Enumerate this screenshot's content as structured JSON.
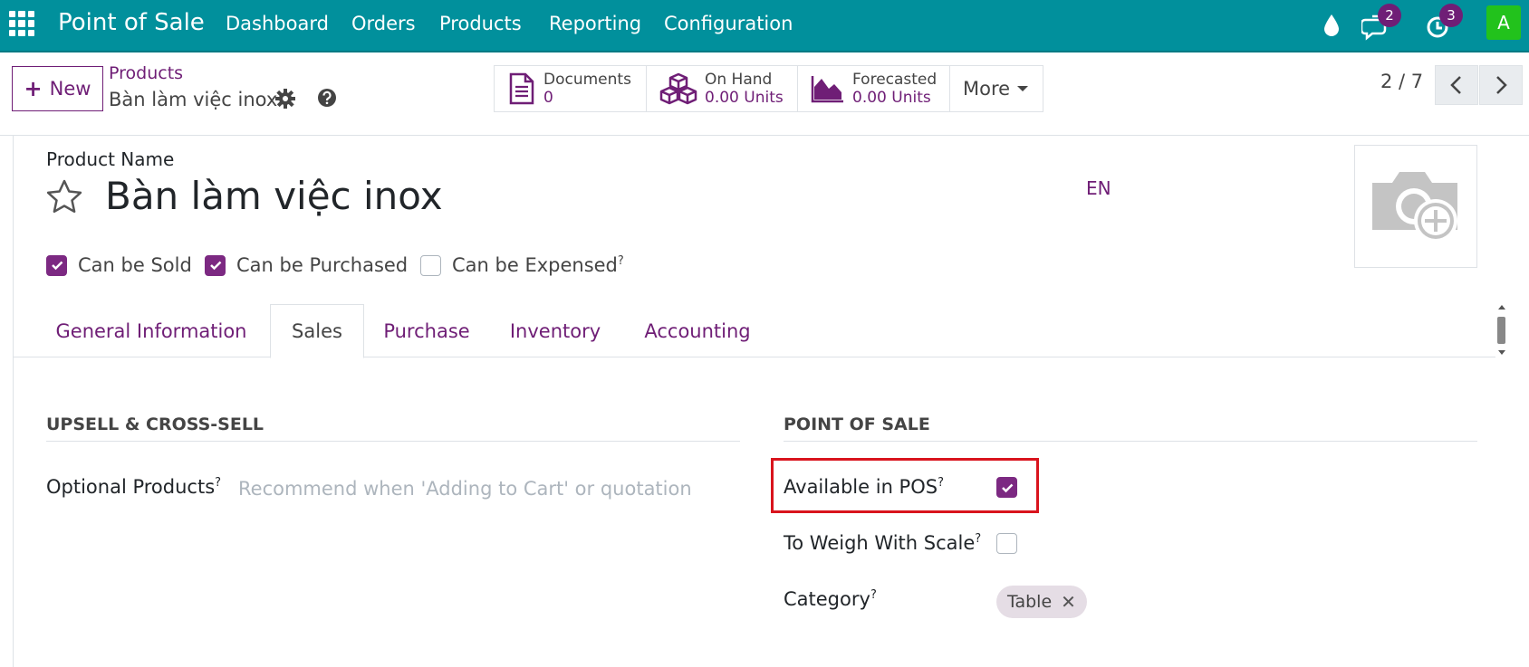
{
  "nav": {
    "brand": "Point of Sale",
    "menu": [
      "Dashboard",
      "Orders",
      "Products",
      "Reporting",
      "Configuration"
    ],
    "messages_count": "2",
    "activities_count": "3",
    "avatar_letter": "A",
    "icons": [
      "apps-grid-icon",
      "water-drop-icon",
      "chat-icon",
      "clock-icon"
    ]
  },
  "control": {
    "new_label": "New",
    "breadcrumb_parent": "Products",
    "breadcrumb_current": "Bàn làm việc inox",
    "stats": [
      {
        "label": "Documents",
        "value": "0",
        "icon": "document-icon"
      },
      {
        "label": "On Hand",
        "value": "0.00 Units",
        "icon": "cubes-icon"
      },
      {
        "label": "Forecasted",
        "value": "0.00 Units",
        "icon": "area-chart-icon"
      }
    ],
    "more_label": "More",
    "pager": "2 / 7"
  },
  "form": {
    "product_name_label": "Product Name",
    "product_name": "Bàn làm việc inox",
    "lang": "EN",
    "checkboxes": [
      {
        "label": "Can be Sold",
        "checked": true
      },
      {
        "label": "Can be Purchased",
        "checked": true
      },
      {
        "label": "Can be Expensed",
        "checked": false,
        "help": "?"
      }
    ],
    "tabs": [
      "General Information",
      "Sales",
      "Purchase",
      "Inventory",
      "Accounting"
    ],
    "active_tab": "Sales",
    "upsell_title": "UPSELL & CROSS-SELL",
    "optional_products_label": "Optional Products",
    "optional_products_placeholder": "Recommend when 'Adding to Cart' or quotation",
    "pos_title": "POINT OF SALE",
    "available_in_pos_label": "Available in POS",
    "available_in_pos": true,
    "to_weigh_label": "To Weigh With Scale",
    "to_weigh": false,
    "category_label": "Category",
    "category_tag": "Table",
    "help_mark": "?"
  },
  "colors": {
    "navbar": "#01909c",
    "accent": "#6f1e76",
    "checkbox_on": "#7c2982",
    "highlight": "#d9141d",
    "avatar": "#22c21c"
  }
}
